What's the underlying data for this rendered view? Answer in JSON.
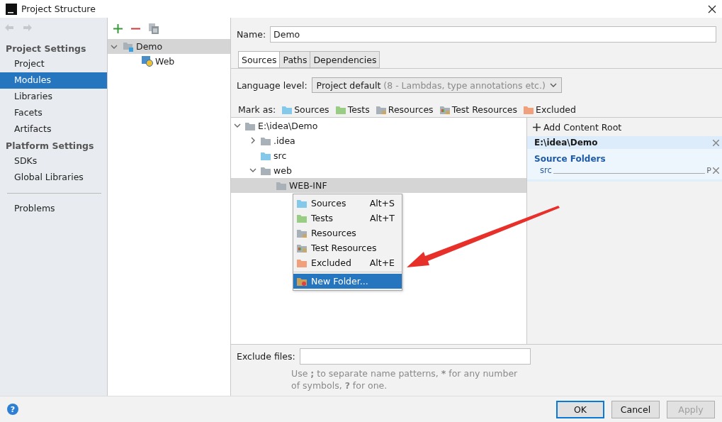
{
  "window": {
    "title": "Project Structure"
  },
  "sidebar": {
    "sections": [
      {
        "heading": "Project Settings",
        "items": [
          {
            "label": "Project",
            "selected": false
          },
          {
            "label": "Modules",
            "selected": true
          },
          {
            "label": "Libraries",
            "selected": false
          },
          {
            "label": "Facets",
            "selected": false
          },
          {
            "label": "Artifacts",
            "selected": false
          }
        ]
      },
      {
        "heading": "Platform Settings",
        "items": [
          {
            "label": "SDKs",
            "selected": false
          },
          {
            "label": "Global Libraries",
            "selected": false
          }
        ]
      },
      {
        "items": [
          {
            "label": "Problems",
            "selected": false
          }
        ]
      }
    ]
  },
  "modules": {
    "tree": [
      {
        "label": "Demo",
        "kind": "module",
        "selected": true,
        "expanded": true,
        "children": [
          {
            "label": "Web",
            "kind": "web",
            "selected": false
          }
        ]
      }
    ]
  },
  "name_field": {
    "label": "Name:",
    "value": "Demo"
  },
  "tabs": [
    {
      "label": "Sources",
      "selected": true
    },
    {
      "label": "Paths",
      "selected": false
    },
    {
      "label": "Dependencies",
      "selected": false
    }
  ],
  "language_level": {
    "label": "Language level:",
    "value": "Project default",
    "hint": "(8 - Lambdas, type annotations etc.)"
  },
  "mark_as": {
    "label": "Mark as:",
    "items": [
      {
        "label": "Sources",
        "kind": "sources"
      },
      {
        "label": "Tests",
        "kind": "tests"
      },
      {
        "label": "Resources",
        "kind": "resources"
      },
      {
        "label": "Test Resources",
        "kind": "test_resources"
      },
      {
        "label": "Excluded",
        "kind": "excluded"
      }
    ]
  },
  "folder_tree": [
    {
      "label": "E:\\idea\\Demo",
      "kind": "folder",
      "expanded": true,
      "selected": false,
      "children": [
        {
          "label": ".idea",
          "kind": "folder",
          "expanded": false,
          "selected": false
        },
        {
          "label": "src",
          "kind": "sources",
          "selected": false
        },
        {
          "label": "web",
          "kind": "folder",
          "expanded": true,
          "selected": false,
          "children": [
            {
              "label": "WEB-INF",
              "kind": "folder",
              "selected": true
            }
          ]
        }
      ]
    }
  ],
  "context_menu": [
    {
      "label": "Sources",
      "kind": "sources",
      "shortcut": "Alt+S",
      "selected": false
    },
    {
      "label": "Tests",
      "kind": "tests",
      "shortcut": "Alt+T",
      "selected": false
    },
    {
      "label": "Resources",
      "kind": "resources",
      "selected": false
    },
    {
      "label": "Test Resources",
      "kind": "test_resources",
      "selected": false
    },
    {
      "label": "Excluded",
      "kind": "excluded",
      "shortcut": "Alt+E",
      "selected": false
    },
    {
      "label": "New Folder...",
      "kind": "new_folder",
      "selected": true
    }
  ],
  "content_root": {
    "add_label": "Add Content Root",
    "path": "E:\\idea\\Demo",
    "section": "Source Folders",
    "folders": [
      {
        "label": "src",
        "action": "P"
      }
    ]
  },
  "exclude_files": {
    "label": "Exclude files:",
    "hint": "Use **;** to separate name patterns, ***** for any number of symbols, **?** for one."
  },
  "footer": {
    "help": "?",
    "buttons": [
      {
        "label": "OK",
        "default": true,
        "disabled": false
      },
      {
        "label": "Cancel",
        "default": false,
        "disabled": false
      },
      {
        "label": "Apply",
        "default": false,
        "disabled": true
      }
    ]
  }
}
